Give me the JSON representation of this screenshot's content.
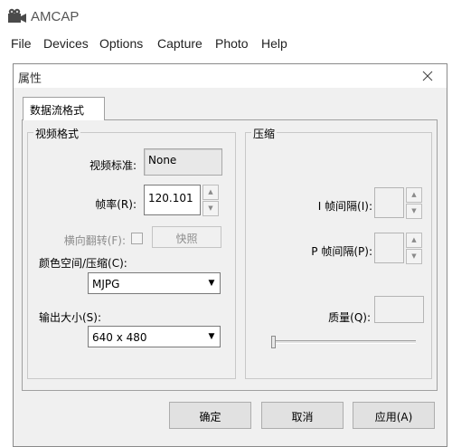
{
  "app": {
    "title": "AMCAP"
  },
  "menu": {
    "items": [
      {
        "label": "File"
      },
      {
        "label": "Devices"
      },
      {
        "label": "Options"
      },
      {
        "label": "Capture"
      },
      {
        "label": "Photo"
      },
      {
        "label": "Help"
      }
    ]
  },
  "dialog": {
    "title": "属性",
    "tab_label": "数据流格式",
    "video_group": {
      "caption": "视频格式",
      "standard_label": "视频标准:",
      "standard_value": "None",
      "framerate_label": "帧率(R):",
      "framerate_value": "120.101",
      "flip_label": "横向翻转(F):",
      "snapshot_label": "快照",
      "colorspace_label": "颜色空间/压缩(C):",
      "colorspace_value": "MJPG",
      "output_size_label": "输出大小(S):",
      "output_size_value": "640 x 480"
    },
    "compression_group": {
      "caption": "压缩",
      "i_frame_label": "I 帧间隔(I):",
      "p_frame_label": "P 帧间隔(P):",
      "quality_label": "质量(Q):",
      "quality_level": 0
    },
    "buttons": {
      "ok": "确定",
      "cancel": "取消",
      "apply": "应用(A)"
    }
  }
}
